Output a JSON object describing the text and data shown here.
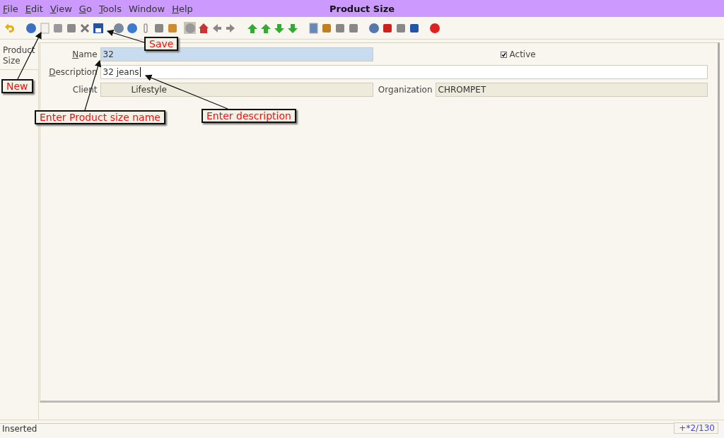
{
  "window": {
    "title": "Product Size"
  },
  "menu": [
    {
      "label": "File",
      "mnemonic": true
    },
    {
      "label": "Edit",
      "mnemonic": true
    },
    {
      "label": "View",
      "mnemonic": true
    },
    {
      "label": "Go",
      "mnemonic": true
    },
    {
      "label": "Tools",
      "mnemonic": true
    },
    {
      "label": "Window",
      "mnemonic": false
    },
    {
      "label": "Help",
      "mnemonic": true
    }
  ],
  "side_tabs": [
    {
      "label": "Product Size",
      "selected": true
    }
  ],
  "form": {
    "name": {
      "label": "Name",
      "mnemonic": true,
      "value": "32"
    },
    "active": {
      "label": "Active",
      "checked": true
    },
    "description": {
      "label": "Description",
      "mnemonic": true,
      "value": "32 jeans"
    },
    "client": {
      "label": "Client",
      "value": "Lifestyle"
    },
    "organization": {
      "label": "Organization",
      "value": "CHROMPET"
    }
  },
  "annotations": [
    {
      "text": "New"
    },
    {
      "text": "Save"
    },
    {
      "text": "Enter Product size name"
    },
    {
      "text": "Enter description"
    }
  ],
  "status_bar": {
    "message": "Inserted",
    "record": "+*2/130"
  }
}
